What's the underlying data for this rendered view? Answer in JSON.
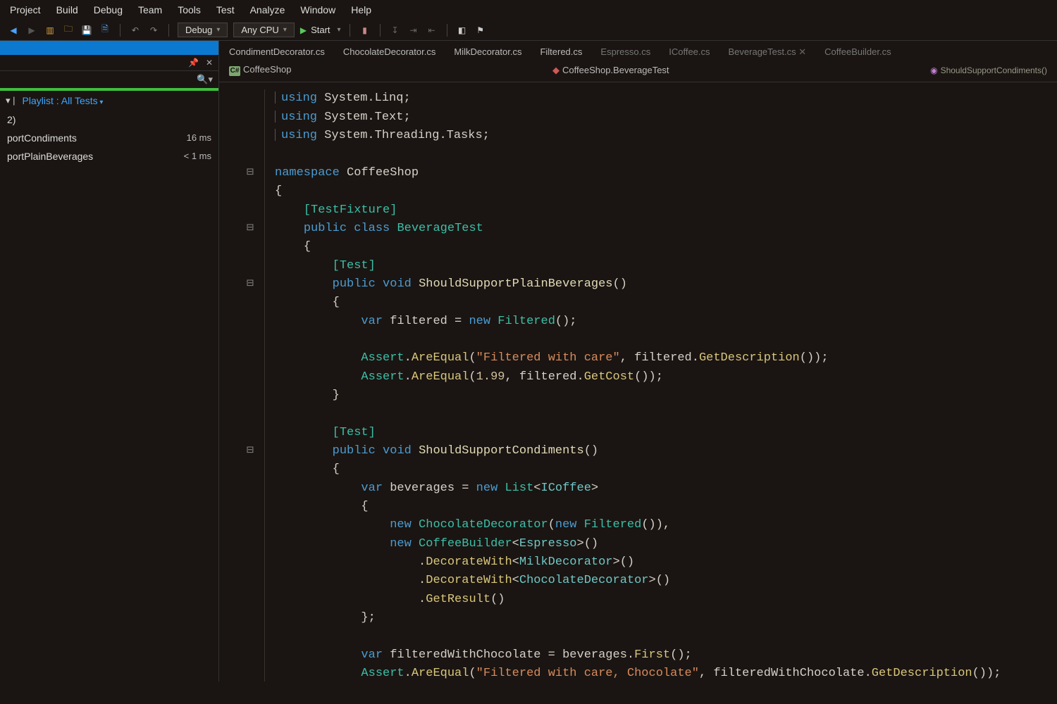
{
  "menu": {
    "items": [
      "Project",
      "Build",
      "Debug",
      "Team",
      "Tools",
      "Test",
      "Analyze",
      "Window",
      "Help"
    ]
  },
  "toolbar": {
    "config": "Debug",
    "platform": "Any CPU",
    "start": "Start"
  },
  "sidebar": {
    "playlist": "Playlist : All Tests",
    "row0": "2)",
    "tests": [
      {
        "name": "portCondiments",
        "time": "16 ms"
      },
      {
        "name": "portPlainBeverages",
        "time": "< 1 ms"
      }
    ]
  },
  "tabs": {
    "row1": [
      "CondimentDecorator.cs",
      "ChocolateDecorator.cs",
      "MilkDecorator.cs",
      "Filtered.cs",
      "Espresso.cs",
      "ICoffee.cs",
      "BeverageTest.cs",
      "CoffeeBuilder.cs"
    ],
    "crumb_ns": "CoffeeShop",
    "crumb_full": "CoffeeShop.BeverageTest",
    "method": "ShouldSupportCondiments()"
  },
  "code": {
    "u1": "System.Linq",
    "u2": "System.Text",
    "u3": "System.Threading.Tasks",
    "ns": "CoffeeShop",
    "attr1": "[TestFixture]",
    "cls": "BeverageTest",
    "attr2": "[Test]",
    "m1": "ShouldSupportPlainBeverages",
    "var1": "filtered",
    "ty_filtered": "Filtered",
    "assert_areq": "AreEqual",
    "str1": "\"Filtered with care\"",
    "get_desc": "GetDescription",
    "num": "1.99",
    "get_cost": "GetCost",
    "m2": "ShouldSupportCondiments",
    "var2": "beverages",
    "list": "List",
    "icoffee": "ICoffee",
    "choco": "ChocolateDecorator",
    "cb": "CoffeeBuilder",
    "espresso": "Espresso",
    "dw": "DecorateWith",
    "milk": "MilkDecorator",
    "gr": "GetResult",
    "fwch": "filteredWithChocolate",
    "first": "First",
    "str2": "\"Filtered with care, Chocolate\""
  }
}
